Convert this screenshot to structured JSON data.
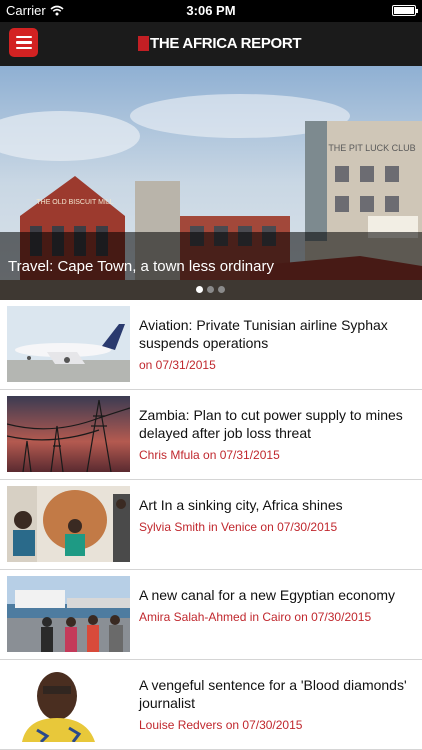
{
  "status_bar": {
    "carrier": "Carrier",
    "time": "3:06 PM"
  },
  "header": {
    "logo_text": "THE AFRICA REPORT",
    "brand_color": "#c21f24",
    "menu_icon": "hamburger-menu-icon"
  },
  "hero": {
    "title": "Travel: Cape Town, a town less ordinary",
    "page_count": 3,
    "active_page": 1
  },
  "articles": [
    {
      "title": "Aviation: Private Tunisian airline Syphax suspends operations",
      "meta": " on 07/31/2015"
    },
    {
      "title": "Zambia: Plan to cut power supply to mines delayed after job loss threat",
      "meta": "Chris Mfula on 07/31/2015"
    },
    {
      "title": "Art In a sinking city, Africa shines",
      "meta": "Sylvia Smith in Venice on 07/30/2015"
    },
    {
      "title": "A new canal for a new Egyptian economy",
      "meta": "Amira Salah-Ahmed in Cairo on 07/30/2015"
    },
    {
      "title": "A vengeful sentence for a 'Blood diamonds' journalist",
      "meta": "Louise Redvers on 07/30/2015"
    }
  ],
  "colors": {
    "meta_text": "#c0282e",
    "navbar_bg": "#1b1b1b",
    "menu_button": "#d32222"
  }
}
